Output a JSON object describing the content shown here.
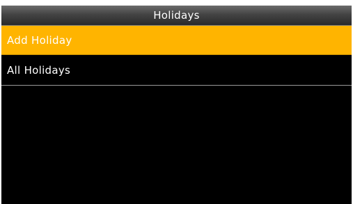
{
  "header": {
    "title": "Holidays"
  },
  "menu": {
    "items": [
      {
        "label": "Add Holiday",
        "selected": true
      },
      {
        "label": "All Holidays",
        "selected": false
      }
    ]
  },
  "colors": {
    "selected_background": "#ffb400",
    "screen_background": "#000000",
    "text": "#ffffff"
  }
}
